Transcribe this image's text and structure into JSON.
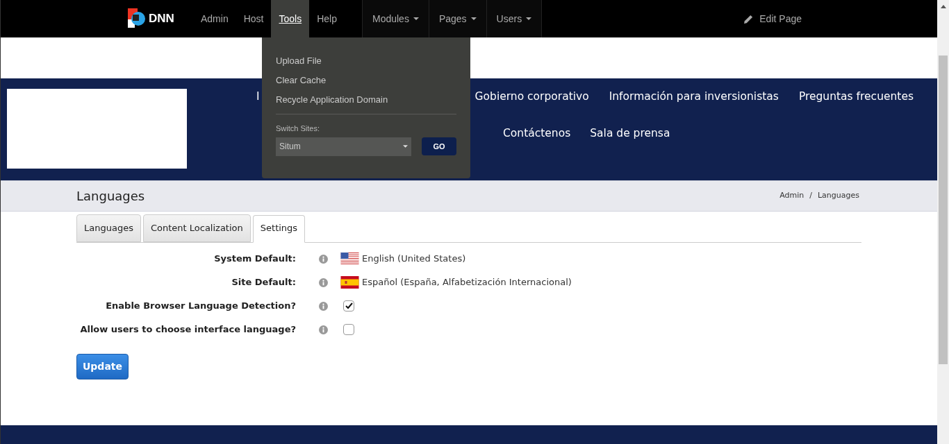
{
  "admin_bar": {
    "logo": "DNN",
    "menu": [
      {
        "label": "Admin",
        "selected": false,
        "kind": "link"
      },
      {
        "label": "Host",
        "selected": false,
        "kind": "link"
      },
      {
        "label": "Tools",
        "selected": true,
        "kind": "link"
      },
      {
        "label": "Help",
        "selected": false,
        "kind": "link"
      },
      {
        "label": "Modules",
        "selected": false,
        "kind": "dropdown"
      },
      {
        "label": "Pages",
        "selected": false,
        "kind": "dropdown"
      },
      {
        "label": "Users",
        "selected": false,
        "kind": "dropdown"
      }
    ],
    "edit_page": "Edit Page"
  },
  "tools_menu": {
    "items": [
      "Upload File",
      "Clear Cache",
      "Recycle Application Domain"
    ],
    "switch_sites_label": "Switch Sites:",
    "site": "Situm",
    "go": "GO"
  },
  "site_nav": {
    "row_1": [
      "I",
      "Gobierno corporativo",
      "Información para inversionistas",
      "Preguntas frecuentes"
    ],
    "row_2": [
      "Contáctenos",
      "Sala de prensa"
    ]
  },
  "page_header": {
    "title": "Languages",
    "breadcrumb": [
      "Admin",
      "/",
      "Languages"
    ]
  },
  "tabs": [
    {
      "label": "Languages",
      "selected": false
    },
    {
      "label": "Content Localization",
      "selected": false
    },
    {
      "label": "Settings",
      "selected": true
    }
  ],
  "settings": [
    {
      "kind": "language",
      "label": "System Default:",
      "flag": {
        "kind": "us"
      },
      "value": "English (United States)"
    },
    {
      "kind": "language",
      "label": "Site Default:",
      "flag": {
        "kind": "es"
      },
      "value": "Español (España, Alfabetización Internacional)"
    },
    {
      "kind": "checkbox",
      "label": "Enable Browser Language Detection?",
      "checked": true
    },
    {
      "kind": "checkbox",
      "label": "Allow users to choose interface language?",
      "checked": false
    }
  ],
  "update_button": "Update"
}
